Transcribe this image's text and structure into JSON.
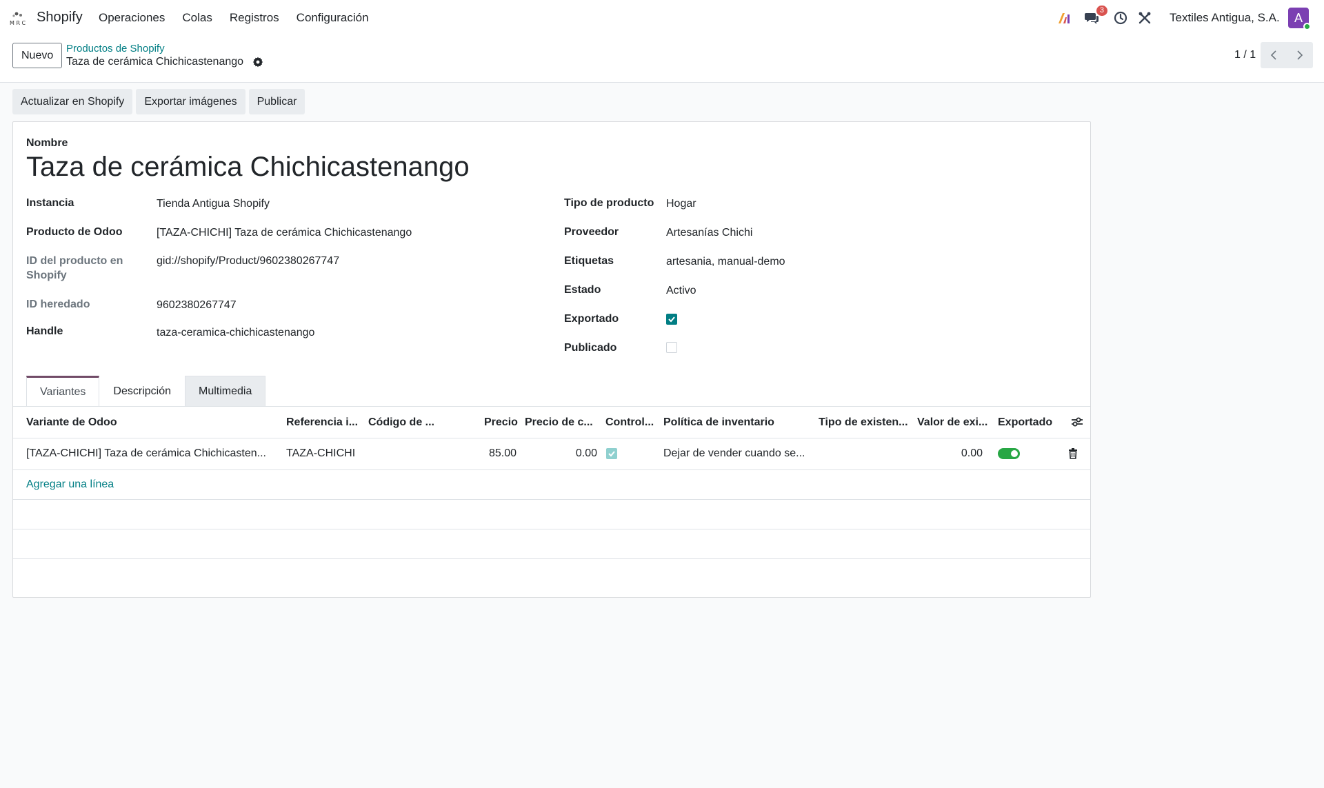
{
  "navbar": {
    "brand": "Shopify",
    "menu": [
      "Operaciones",
      "Colas",
      "Registros",
      "Configuración"
    ],
    "messages_badge": "3",
    "company": "Textiles Antigua, S.A.",
    "avatar_initial": "A"
  },
  "control_panel": {
    "new_button": "Nuevo",
    "breadcrumb_parent": "Productos de Shopify",
    "breadcrumb_current": "Taza de cerámica Chichicastenango",
    "pager": "1 / 1"
  },
  "actions": [
    "Actualizar en Shopify",
    "Exportar imágenes",
    "Publicar"
  ],
  "form": {
    "name_label": "Nombre",
    "name_value": "Taza de cerámica Chichicastenango",
    "left_fields": {
      "instancia_label": "Instancia",
      "instancia_value": "Tienda Antigua Shopify",
      "producto_label": "Producto de Odoo",
      "producto_value": "[TAZA-CHICHI] Taza de cerámica Chichicastenango",
      "id_producto_label_1": "ID del producto en",
      "id_producto_label_2": "Shopify",
      "id_producto_value": "gid://shopify/Product/9602380267747",
      "id_heredado_label": "ID heredado",
      "id_heredado_value": "9602380267747",
      "handle_label": "Handle",
      "handle_value": "taza-ceramica-chichicastenango"
    },
    "right_fields": {
      "tipo_label": "Tipo de producto",
      "tipo_value": "Hogar",
      "proveedor_label": "Proveedor",
      "proveedor_value": "Artesanías Chichi",
      "etiquetas_label": "Etiquetas",
      "etiquetas_value": "artesania, manual-demo",
      "estado_label": "Estado",
      "estado_value": "Activo",
      "exportado_label": "Exportado",
      "exportado_checked": true,
      "publicado_label": "Publicado",
      "publicado_checked": false
    }
  },
  "tabs": [
    "Variantes",
    "Descripción",
    "Multimedia"
  ],
  "variants_table": {
    "columns": [
      "Variante de Odoo",
      "Referencia i...",
      "Código de ...",
      "Precio",
      "Precio de c...",
      "Control...",
      "Política de inventario",
      "Tipo de existen...",
      "Valor de exi...",
      "Exportado"
    ],
    "rows": [
      {
        "variante": "[TAZA-CHICHI] Taza de cerámica Chichicasten...",
        "referencia": "TAZA-CHICHI",
        "codigo": "",
        "precio": "85.00",
        "precio_comparacion": "0.00",
        "control": true,
        "politica": "Dejar de vender cuando se...",
        "tipo_existencia": "",
        "valor_existencia": "0.00",
        "exportado": true
      }
    ],
    "add_line": "Agregar una línea"
  },
  "colors": {
    "accent": "#017e84",
    "tab_active": "#714b67",
    "avatar": "#7b3fb2",
    "toggle_on": "#28a745",
    "badge": "#d9534f"
  }
}
